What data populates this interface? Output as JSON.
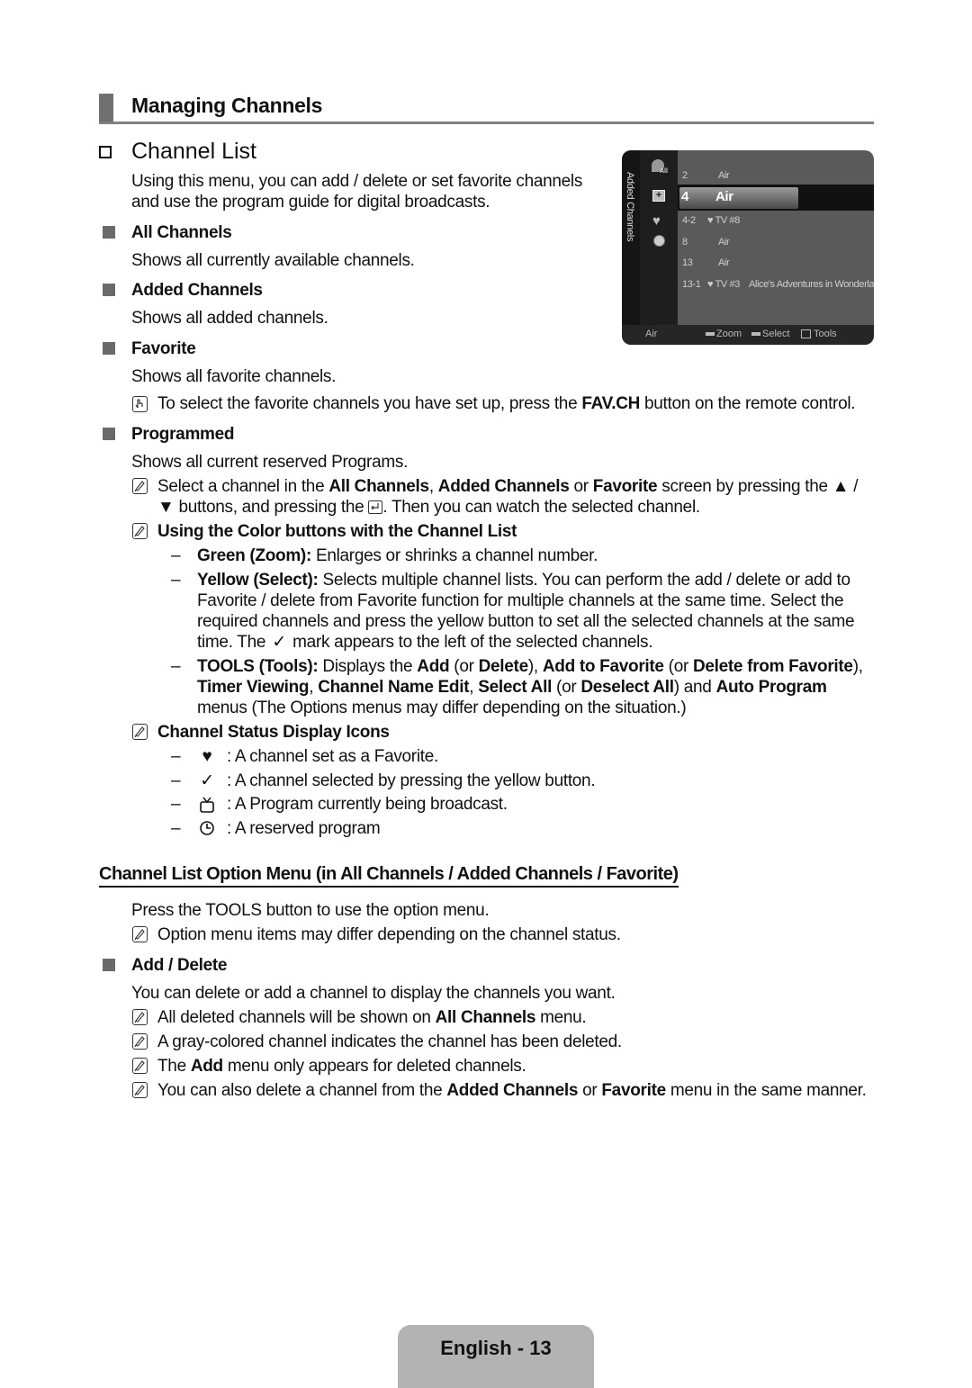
{
  "section": {
    "title": "Managing Channels"
  },
  "subsection": {
    "title": "Channel List",
    "intro": [
      "Using this menu, you can add / delete or set favorite channels",
      "and use the program guide for digital broadcasts."
    ]
  },
  "items": [
    {
      "heading": "All Channels",
      "desc": "Shows all currently available channels."
    },
    {
      "heading": "Added Channels",
      "desc": "Shows all added channels."
    },
    {
      "heading": "Favorite",
      "desc": "Shows all favorite channels."
    },
    {
      "heading": "Programmed",
      "desc": "Shows all current reserved Programs."
    }
  ],
  "fav_note": {
    "pre": "To select the favorite channels you have set up, press the ",
    "bold": "FAV.CH",
    "post": " button on the remote control."
  },
  "select_note": {
    "l1_a": "Select a channel in the ",
    "l1_b": "All Channels",
    "l1_c": ", ",
    "l1_d": "Added Channels",
    "l1_e": " or ",
    "l1_f": "Favorite",
    "l1_g": " screen by pressing the ▲ /",
    "l2_a": "▼ buttons, and pressing the ",
    "l2_b": ". Then you can watch the selected channel."
  },
  "color_note": {
    "title": "Using the Color buttons with the Channel List"
  },
  "color_items": {
    "green_label": "Green (Zoom):",
    "green_text": " Enlarges or shrinks a channel number.",
    "yellow_label": "Yellow (Select):",
    "yellow_l1": " Selects multiple channel lists. You can perform the add / delete or add to",
    "yellow_l2": "Favorite / delete from Favorite function for multiple channels at the same time. Select the",
    "yellow_l3": "required channels and press the yellow button to set all the selected channels at the same",
    "yellow_l4a": "time. The ",
    "yellow_l4b": " mark appears to the left of the selected channels.",
    "tools_label": "TOOLS (Tools):",
    "tools_l1a": " Displays the ",
    "tools_add": "Add",
    "tools_l1b": " (or ",
    "tools_delete": "Delete",
    "tools_l1c": "), ",
    "tools_addfav": "Add to Favorite",
    "tools_l1d": " (or ",
    "tools_delfav": "Delete from Favorite",
    "tools_l1e": "),",
    "tools_timer": "Timer Viewing",
    "tools_sep1": ", ",
    "tools_cne": "Channel Name Edit",
    "tools_sep2": ", ",
    "tools_selall": "Select All",
    "tools_l2a": " (or ",
    "tools_desel": "Deselect All",
    "tools_l2b": ") and ",
    "tools_auto": "Auto Program",
    "tools_l3": "menus (The Options menus may differ depending on the situation.)"
  },
  "status_icons": {
    "title": "Channel Status Display Icons",
    "rows": [
      {
        "icon": "heart-icon",
        "glyph": "♥",
        "text": ": A channel set as a Favorite."
      },
      {
        "icon": "check-icon",
        "glyph": "✓",
        "text": ": A channel selected by pressing the yellow button."
      },
      {
        "icon": "tv-icon",
        "glyph": "",
        "text": ": A Program currently being broadcast."
      },
      {
        "icon": "clock-icon",
        "glyph": "",
        "text": ": A reserved program"
      }
    ]
  },
  "option_menu": {
    "title": "Channel List Option Menu (in All Channels / Added Channels / Favorite)",
    "intro": "Press the TOOLS button to use the option menu.",
    "note": "Option menu items may differ depending on the channel status.",
    "add_delete": {
      "heading": "Add / Delete",
      "desc": "You can delete or add a channel to display the channels you want.",
      "n1a": "All deleted channels will be shown on ",
      "n1b": "All Channels",
      "n1c": " menu.",
      "n2": "A gray-colored channel indicates the channel has been deleted.",
      "n3a": "The ",
      "n3b": "Add",
      "n3c": " menu only appears for deleted channels.",
      "n4a": "You can also delete a channel from the ",
      "n4b": "Added Channels",
      "n4c": " or ",
      "n4d": "Favorite",
      "n4e": " menu in the same manner."
    }
  },
  "tv_screen": {
    "side_label": "Added Channels",
    "all_badge": "All",
    "rows": [
      {
        "num": "2",
        "name": "Air",
        "program": ""
      },
      {
        "num": "4",
        "name": "Air",
        "program": "",
        "selected": true
      },
      {
        "num": "4-2",
        "name": "♥ TV #8",
        "program": ""
      },
      {
        "num": "8",
        "name": "Air",
        "program": ""
      },
      {
        "num": "13",
        "name": "Air",
        "program": ""
      },
      {
        "num": "13-1",
        "name": "♥ TV #3",
        "program": "Alice's Adventures in Wonderland"
      }
    ],
    "footer": {
      "status": "Air",
      "zoom": "Zoom",
      "select": "Select",
      "tools": "Tools"
    }
  },
  "page_footer": {
    "label": "English - 13"
  }
}
